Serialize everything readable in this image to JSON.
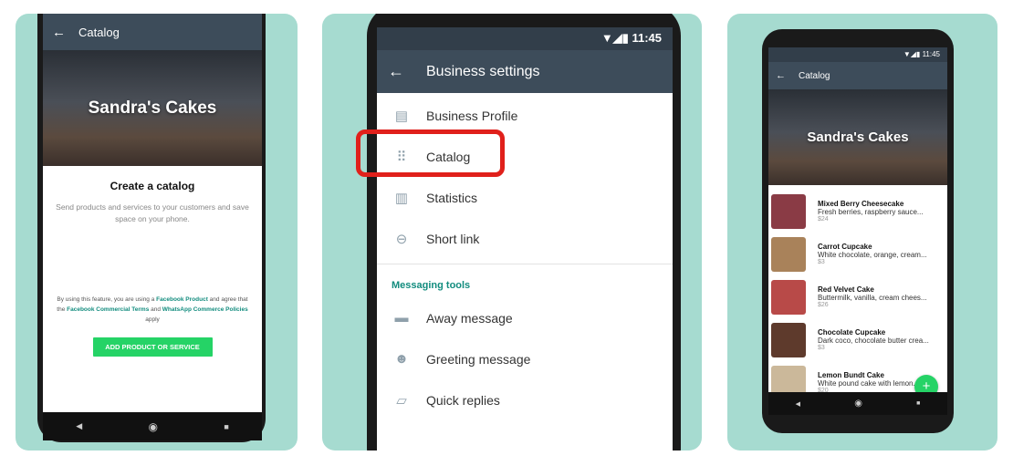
{
  "panel1": {
    "title": "Catalog",
    "business_name": "Sandra's Cakes",
    "heading": "Create a catalog",
    "description": "Send products and services to your customers and save space on your phone.",
    "legal": {
      "p1": "By using this feature, you are using a ",
      "link1": "Facebook Product",
      "p2": " and agree that the ",
      "link2": "Facebook Commercial Terms",
      "p3": " and ",
      "link3": "WhatsApp Commerce Policies",
      "p4": " apply"
    },
    "button": "ADD PRODUCT OR SERVICE"
  },
  "panel2": {
    "time": "11:45",
    "title": "Business settings",
    "items": [
      {
        "label": "Business Profile",
        "icon": "store-icon"
      },
      {
        "label": "Catalog",
        "icon": "grid-icon"
      },
      {
        "label": "Statistics",
        "icon": "chart-icon"
      },
      {
        "label": "Short link",
        "icon": "link-icon"
      }
    ],
    "section": "Messaging tools",
    "tools": [
      {
        "label": "Away message",
        "icon": "away-icon"
      },
      {
        "label": "Greeting message",
        "icon": "greeting-icon"
      },
      {
        "label": "Quick replies",
        "icon": "quick-reply-icon"
      }
    ],
    "highlight_color": "#e0201b"
  },
  "panel3": {
    "time": "11:45",
    "title": "Catalog",
    "business_name": "Sandra's Cakes",
    "products": [
      {
        "name": "Mixed Berry Cheesecake",
        "desc": "Fresh berries, raspberry sauce...",
        "price": "$24"
      },
      {
        "name": "Carrot Cupcake",
        "desc": "White chocolate, orange, cream...",
        "price": "$3"
      },
      {
        "name": "Red Velvet Cake",
        "desc": "Buttermilk, vanilla, cream chees...",
        "price": "$26"
      },
      {
        "name": "Chocolate Cupcake",
        "desc": "Dark coco, chocolate butter crea...",
        "price": "$3"
      },
      {
        "name": "Lemon Bundt Cake",
        "desc": "White pound cake with lemon...",
        "price": "$20"
      }
    ]
  },
  "colors": {
    "accent": "#25d366",
    "appbar": "#3d4c5a",
    "card": "#a6dbd0"
  }
}
